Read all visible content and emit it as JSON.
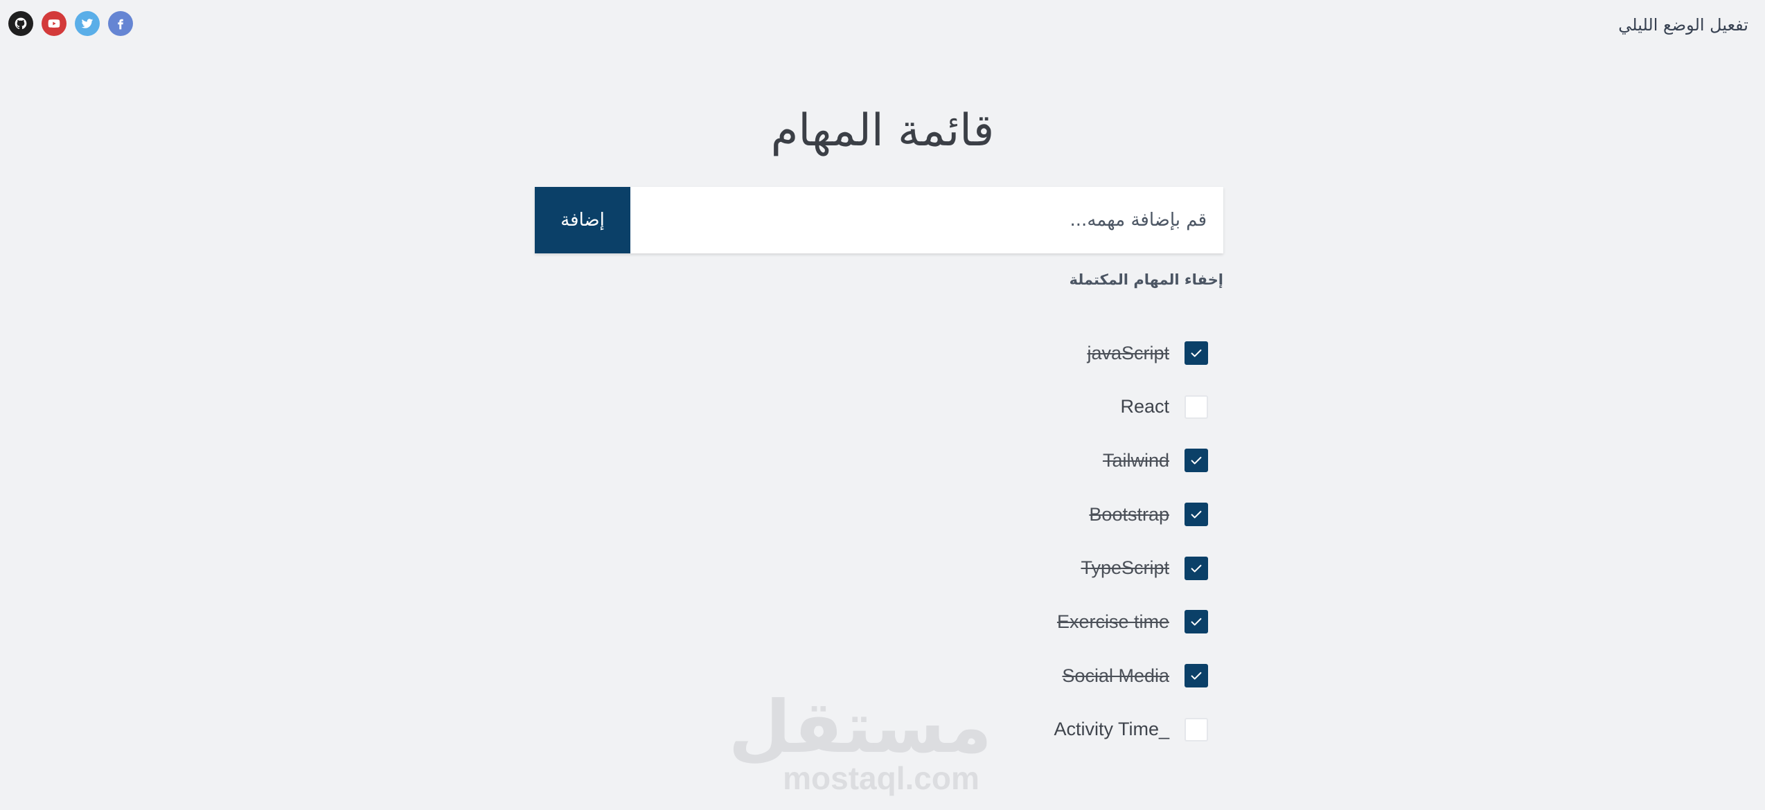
{
  "header": {
    "dark_mode_label": "تفعيل الوضع الليلي",
    "social": [
      {
        "name": "github-icon",
        "color": "#1f1f1f"
      },
      {
        "name": "youtube-icon",
        "color": "#d33a3a"
      },
      {
        "name": "twitter-icon",
        "color": "#5aaee8"
      },
      {
        "name": "facebook-icon",
        "color": "#6585d3"
      }
    ]
  },
  "main": {
    "title": "قائمة المهام",
    "input_placeholder": "قم بإضافة مهمه...",
    "add_button_label": "إضافة",
    "hide_completed_label": "إخفاء المهام المكتملة"
  },
  "tasks": [
    {
      "label": "javaScript",
      "done": true
    },
    {
      "label": "React",
      "done": false
    },
    {
      "label": "Tailwind",
      "done": true
    },
    {
      "label": "Bootstrap",
      "done": true
    },
    {
      "label": "TypeScript",
      "done": true
    },
    {
      "label": "Exercise time",
      "done": true
    },
    {
      "label": "Social Media",
      "done": true
    },
    {
      "label": "Activity Time_",
      "done": false
    }
  ],
  "watermark": {
    "arabic": "مستقل",
    "latin": "mostaql.com"
  },
  "colors": {
    "accent": "#0b4068",
    "background": "#f1f2f4"
  }
}
